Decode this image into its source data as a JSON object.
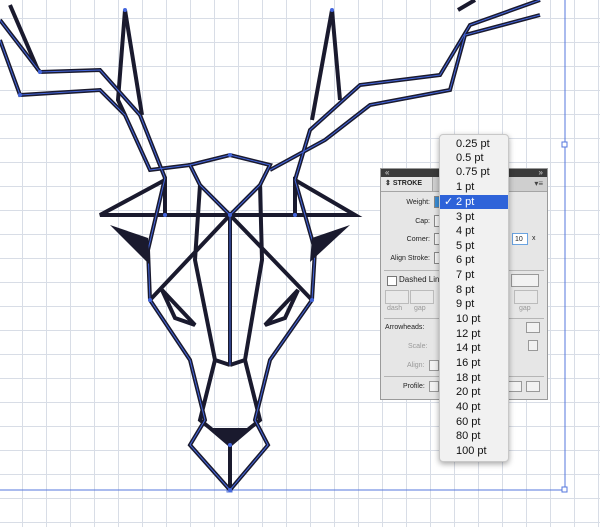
{
  "stroke_panel": {
    "tab_label": "STROKE",
    "weight_label": "Weight:",
    "cap_label": "Cap:",
    "corner_label": "Corner:",
    "limit_value": "10",
    "limit_suffix": "x",
    "align_stroke_label": "Align Stroke:",
    "dashed_line_label": "Dashed Line",
    "dash_label": "dash",
    "gap_label": "gap",
    "gap_label_2": "gap",
    "arrowheads_label": "Arrowheads:",
    "scale_label": "Scale:",
    "align_label": "Align:",
    "profile_label": "Profile:"
  },
  "weight_dropdown": {
    "selected": "2 pt",
    "check_mark": "✓",
    "options": [
      "0.25 pt",
      "0.5 pt",
      "0.75 pt",
      "1 pt",
      "2 pt",
      "3 pt",
      "4 pt",
      "5 pt",
      "6 pt",
      "7 pt",
      "8 pt",
      "9 pt",
      "10 pt",
      "12 pt",
      "14 pt",
      "16 pt",
      "18 pt",
      "20 pt",
      "40 pt",
      "60 pt",
      "80 pt",
      "100 pt"
    ]
  },
  "colors": {
    "selection_blue": "#2e63d9",
    "artwork_stroke": "#1a1a2e",
    "path_highlight": "#4466dd",
    "grid": "#d8dde6"
  }
}
